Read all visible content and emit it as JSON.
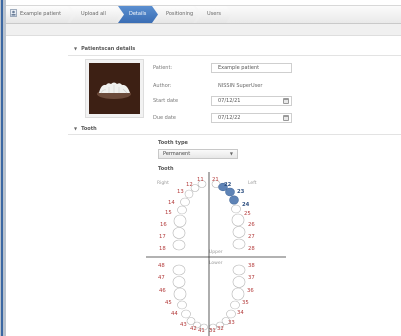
{
  "breadcrumb": [
    {
      "label": "Example patient",
      "active": false,
      "icon": "patient-icon"
    },
    {
      "label": "Upload all",
      "active": false
    },
    {
      "label": "Details",
      "active": true
    },
    {
      "label": "Positioning",
      "active": false
    },
    {
      "label": "Users",
      "active": false
    }
  ],
  "patientscan": {
    "heading": "Patientscan details",
    "fields": {
      "patient_label": "Patient:",
      "patient_value": "Example patient",
      "author_label": "Author:",
      "author_value": "NISSIN SuperUser",
      "start_label": "Start date",
      "start_value": "07/12/21",
      "due_label": "Due date",
      "due_value": "07/12/22"
    }
  },
  "tooth": {
    "heading": "Tooth",
    "type_label": "Tooth type",
    "type_value": "Permanent",
    "chart_label": "Tooth",
    "right_label": "Right",
    "left_label": "Left",
    "upper_label": "Upper",
    "lower_label": "Lower",
    "numbers": {
      "n11": "11",
      "n12": "12",
      "n13": "13",
      "n14": "14",
      "n15": "15",
      "n16": "16",
      "n17": "17",
      "n18": "18",
      "n21": "21",
      "n22": "22",
      "n23": "23",
      "n24": "24",
      "n25": "25",
      "n26": "26",
      "n27": "27",
      "n28": "28",
      "n31": "31",
      "n32": "32",
      "n33": "33",
      "n34": "34",
      "n35": "35",
      "n36": "36",
      "n37": "37",
      "n38": "38",
      "n41": "41",
      "n42": "42",
      "n43": "43",
      "n44": "44",
      "n45": "45",
      "n46": "46",
      "n47": "47",
      "n48": "48"
    },
    "selected": [
      "22",
      "23",
      "24"
    ],
    "colors": {
      "selected": "#5e83b6",
      "number": "#b33a3a",
      "selected_number": "#2d4f80"
    }
  },
  "colors": {
    "accent": "#3a6db4"
  }
}
